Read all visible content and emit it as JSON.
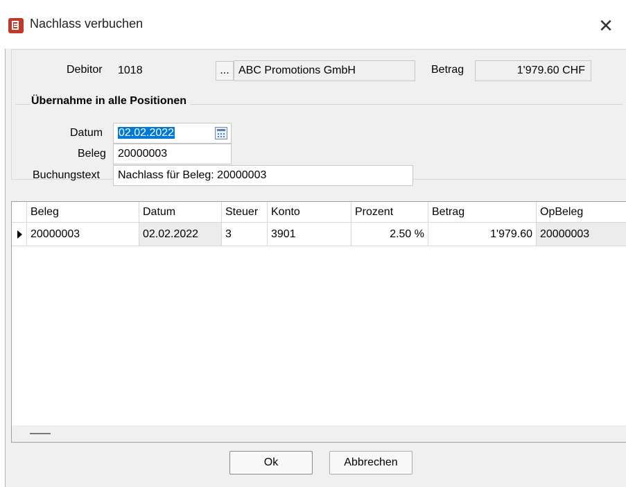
{
  "window": {
    "title": "Nachlass verbuchen",
    "close_label": "✕"
  },
  "header": {
    "debitor_label": "Debitor",
    "debitor_value": "1018",
    "lookup_label": "...",
    "debitor_name": "ABC Promotions GmbH",
    "betrag_label": "Betrag",
    "betrag_value": "1'979.60 CHF"
  },
  "group": {
    "legend": "Übernahme in alle Positionen",
    "datum_label": "Datum",
    "datum_value": "02.02.2022",
    "beleg_label": "Beleg",
    "beleg_value": "20000003",
    "buchungstext_label": "Buchungstext",
    "buchungstext_value": "Nachlass für Beleg: 20000003"
  },
  "table": {
    "columns": [
      "Beleg",
      "Datum",
      "Steuer",
      "Konto",
      "Prozent",
      "Betrag",
      "OpBeleg"
    ],
    "rows": [
      [
        "20000003",
        "02.02.2022",
        "3",
        "3901",
        "2.50 %",
        "1'979.60",
        "20000003"
      ]
    ]
  },
  "buttons": {
    "ok": "Ok",
    "cancel": "Abbrechen"
  },
  "icons": {
    "app": "document-list-icon",
    "calendar": "calendar-icon",
    "row_pointer": "row-pointer-icon"
  },
  "colors": {
    "selection": "#0078d7",
    "app_icon": "#c0392b"
  }
}
